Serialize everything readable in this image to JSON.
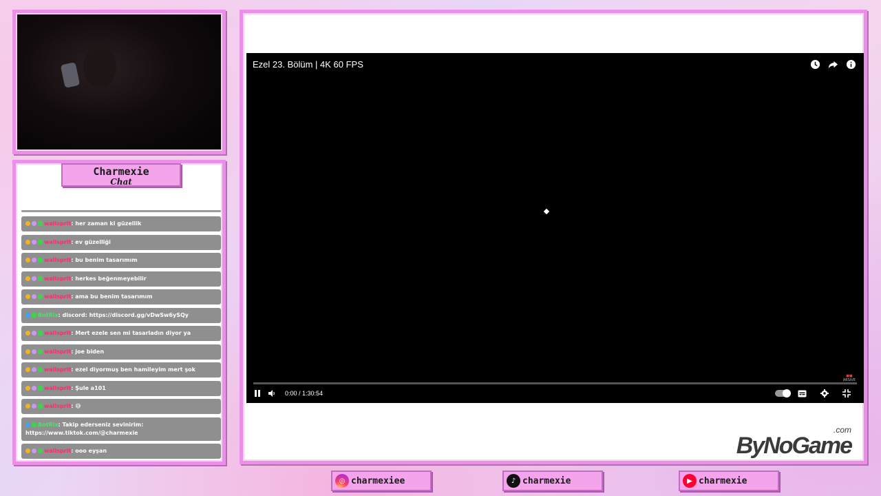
{
  "chat": {
    "title": "Charmexie",
    "subtitle": "Chat",
    "messages": [
      {
        "user": "wallsprit",
        "kind": "user",
        "text": ": her zaman ki güzellik"
      },
      {
        "user": "wallsprit",
        "kind": "user",
        "text": ": ev güzelliği"
      },
      {
        "user": "wallsprit",
        "kind": "user",
        "text": ": bu benim tasarımım"
      },
      {
        "user": "wallsprit",
        "kind": "user",
        "text": ": herkes beğenmeyebilir"
      },
      {
        "user": "wallsprit",
        "kind": "user",
        "text": ": ama bu benim tasarımım"
      },
      {
        "user": "BotRix",
        "kind": "bot",
        "text": ": discord: https://discord.gg/vDwSw6ySQy"
      },
      {
        "user": "wallsprit",
        "kind": "user",
        "text": ": Mert ezele sen mi tasarladın diyor ya"
      },
      {
        "user": "wallsprit",
        "kind": "user",
        "text": ": joe biden"
      },
      {
        "user": "wallsprit",
        "kind": "user",
        "text": ": ezel diyormuş ben hamileyim mert şok"
      },
      {
        "user": "wallsprit",
        "kind": "user",
        "text": ": Şule a101"
      },
      {
        "user": "wallsprit",
        "kind": "user",
        "text": ": 😅"
      },
      {
        "user": "BotRix",
        "kind": "bot",
        "text": ": Takip ederseniz sevinirim: https://www.tiktok.com/@charmexie"
      },
      {
        "user": "wallsprit",
        "kind": "user",
        "text": ": ooo eyşan"
      }
    ]
  },
  "player": {
    "title": "Ezel 23. Bölüm | 4K 60 FPS",
    "time": "0:00 / 1:30:54",
    "progress": 0.0,
    "icons": [
      "clock-icon",
      "share-icon",
      "info-icon"
    ]
  },
  "brand": {
    "name": "ByNoGame",
    "suffix": ".com"
  },
  "socials": [
    {
      "platform": "instagram",
      "handle": "charmexiee"
    },
    {
      "platform": "tiktok",
      "handle": "charmexie"
    },
    {
      "platform": "youtube",
      "handle": "charmexie"
    }
  ]
}
